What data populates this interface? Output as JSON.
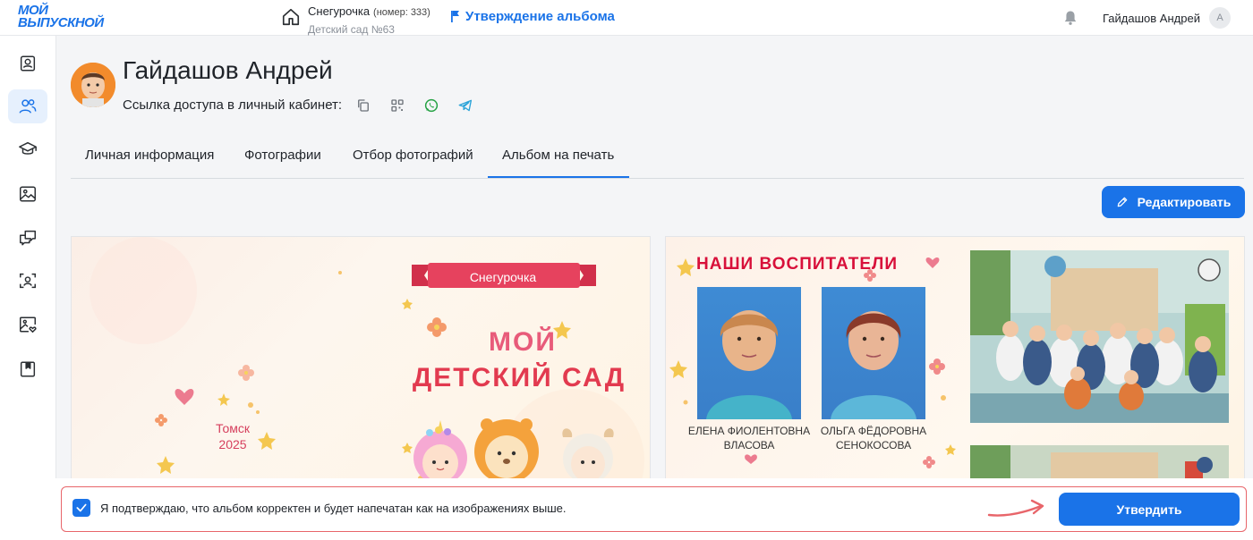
{
  "topbar": {
    "logo_line1": "МОЙ",
    "logo_line2": "ВЫПУСКНОЙ",
    "group_name": "Снегурочка",
    "group_number": "(номер: 333)",
    "group_sub": "Детский сад №63",
    "approval_link": "Утверждение альбома",
    "user_name": "Гайдашов Андрей",
    "user_avatar_letter": "А"
  },
  "sidebar": {
    "icons": [
      "profile-icon",
      "users-icon",
      "graduation-cap-icon",
      "image-icon",
      "chat-icon",
      "face-scan-icon",
      "photo-heart-icon",
      "bookmark-icon"
    ],
    "active_index": 1,
    "expand_label": "»"
  },
  "profile": {
    "name": "Гайдашов Андрей",
    "access_label": "Ссылка доступа в личный кабинет:",
    "access_icons": [
      "copy-icon",
      "qr-code-icon",
      "whatsapp-icon",
      "telegram-icon"
    ]
  },
  "tabs": [
    {
      "label": "Личная информация",
      "active": false
    },
    {
      "label": "Фотографии",
      "active": false
    },
    {
      "label": "Отбор фотографий",
      "active": false
    },
    {
      "label": "Альбом на печать",
      "active": true
    }
  ],
  "edit_button": "Редактировать",
  "album_page1": {
    "ribbon": "Снегурочка",
    "title_line1": "МОЙ",
    "title_line2": "ДЕТСКИЙ САД",
    "city": "Томск",
    "year": "2025"
  },
  "album_page2": {
    "title": "НАШИ ВОСПИТАТЕЛИ",
    "teacher1_line1": "ЕЛЕНА ФИОЛЕНТОВНА",
    "teacher1_line2": "ВЛАСОВА",
    "teacher2_line1": "ОЛЬГА ФЁДОРОВНА",
    "teacher2_line2": "СЕНОКОСОВА"
  },
  "confirm": {
    "checked": true,
    "text": "Я подтверждаю, что альбом корректен и будет напечатан как на изображениях выше.",
    "approve_button": "Утвердить"
  },
  "colors": {
    "accent": "#1a73e8",
    "confirm_border": "#e8656a",
    "album_red": "#e23a4f"
  }
}
